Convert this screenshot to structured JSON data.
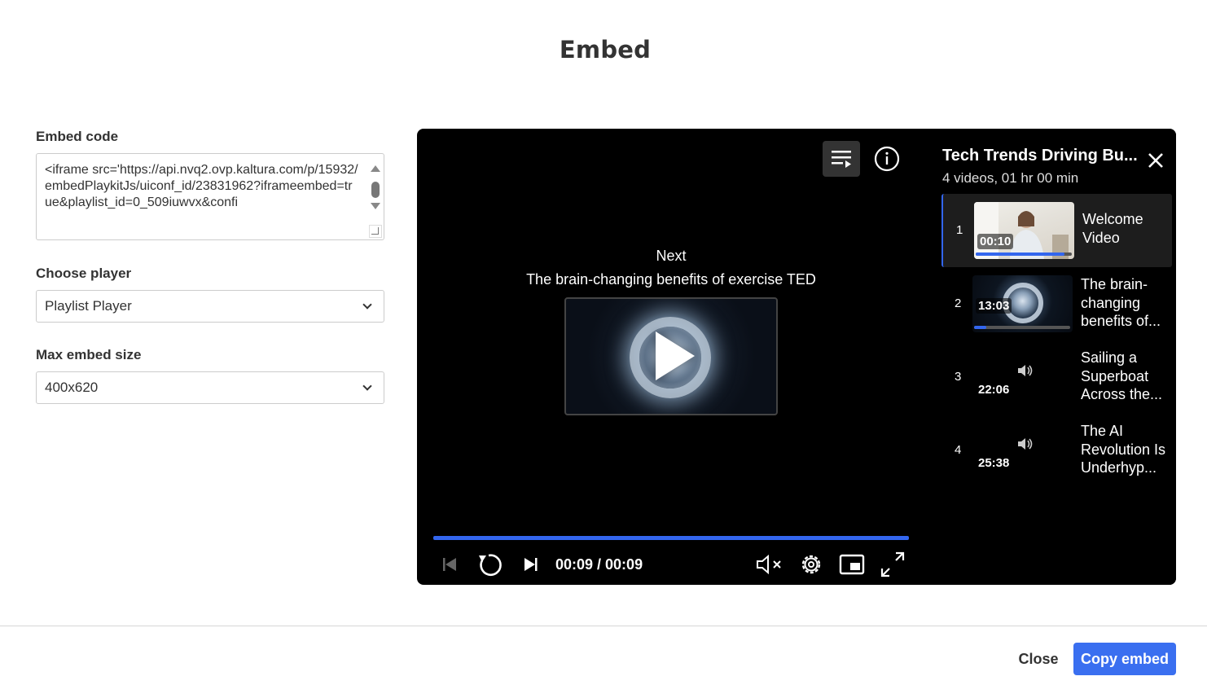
{
  "dialog": {
    "title": "Embed"
  },
  "form": {
    "embed_code_label": "Embed code",
    "embed_code_value": "<iframe src='https://api.nvq2.ovp.kaltura.com/p/15932/embedPlaykitJs/uiconf_id/23831962?iframeembed=true&playlist_id=0_509iuwvx&confi",
    "player_label": "Choose player",
    "player_value": "Playlist Player",
    "size_label": "Max embed size",
    "size_value": "400x620"
  },
  "player": {
    "next_label": "Next",
    "next_title": "The brain-changing benefits of exercise TED",
    "progress_fraction": 1.0,
    "time": "00:09 / 00:09",
    "accent": "#3366ee"
  },
  "playlist": {
    "title": "Tech Trends Driving Bu...",
    "subtitle": "4 videos, 01 hr 00 min",
    "items": [
      {
        "num": "1",
        "title": "Welcome Video",
        "duration": "00:10",
        "progress": 0.9,
        "active": true
      },
      {
        "num": "2",
        "title": "The brain-changing benefits of...",
        "duration": "13:03",
        "progress": 0.12,
        "active": false
      },
      {
        "num": "3",
        "title": "Sailing a Superboat Across the...",
        "duration": "22:06",
        "active": false
      },
      {
        "num": "4",
        "title": "The AI Revolution Is Underhyp...",
        "duration": "25:38",
        "active": false
      }
    ]
  },
  "footer": {
    "close_label": "Close",
    "copy_label": "Copy embed",
    "copy_color": "#3a6ff0"
  }
}
